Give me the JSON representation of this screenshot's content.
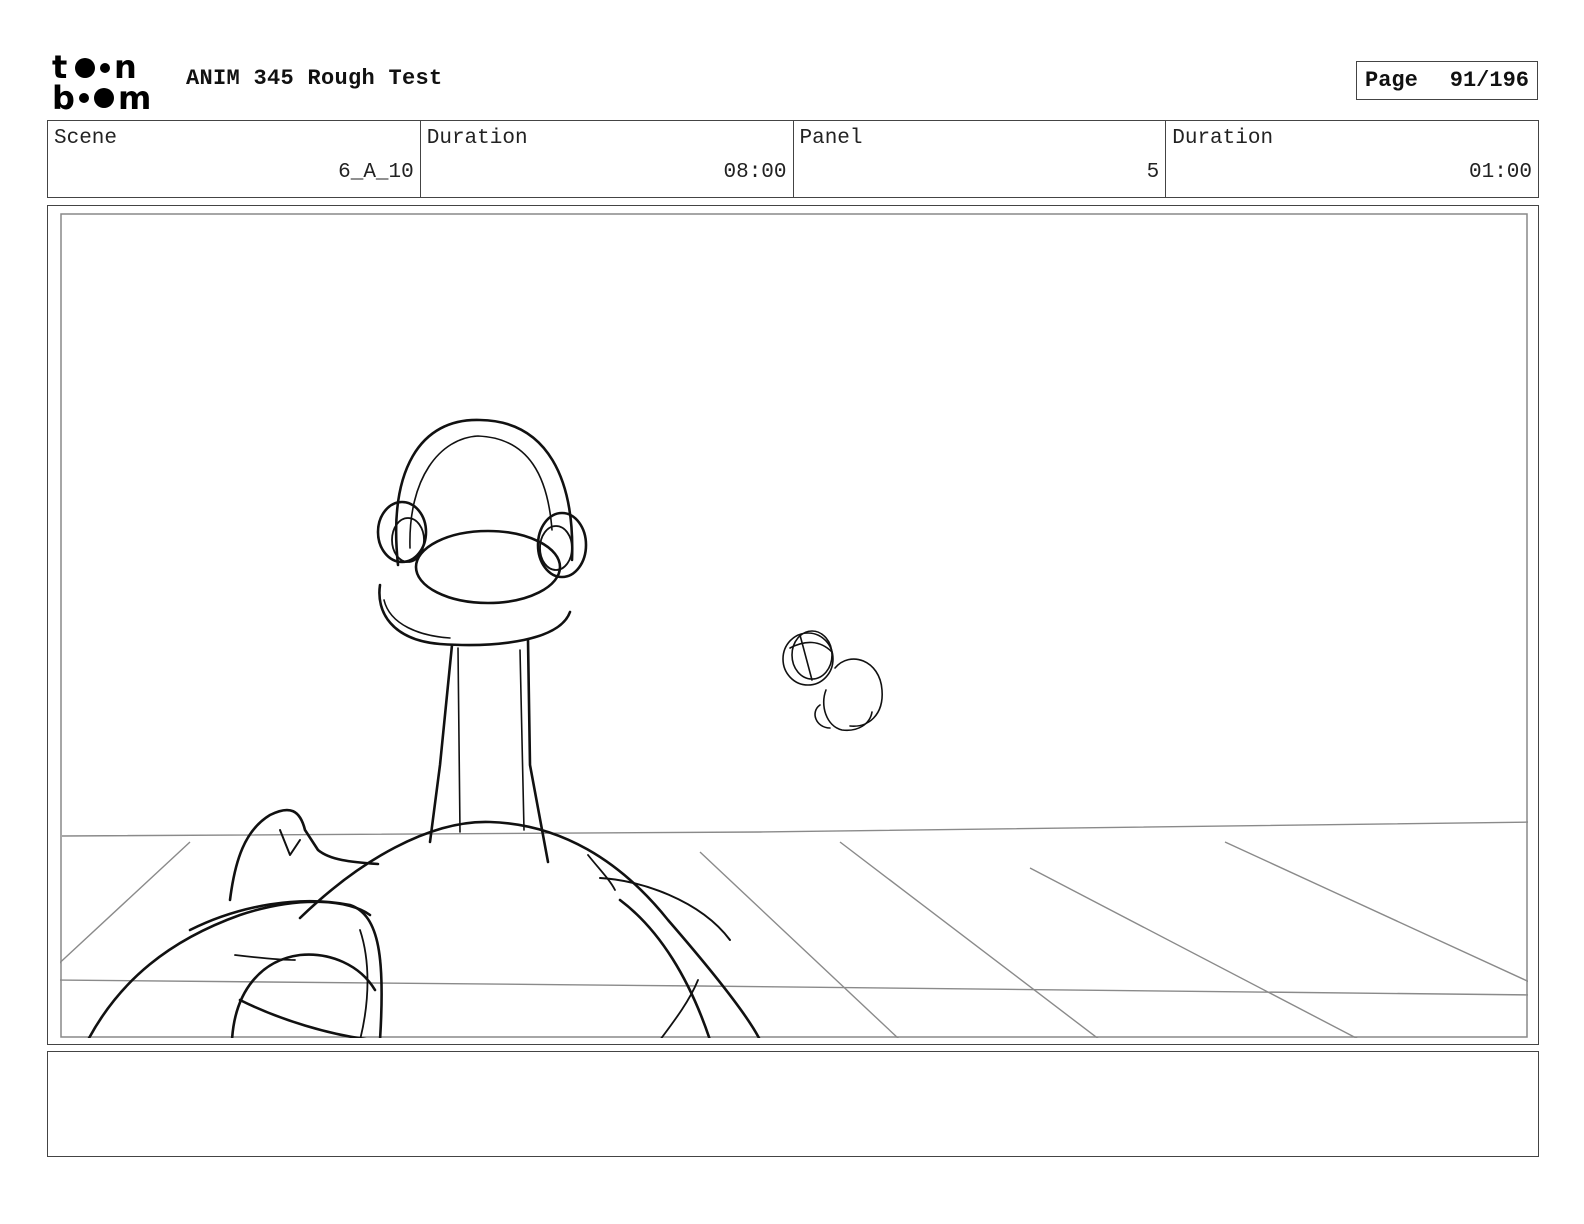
{
  "header": {
    "logo_text_top": "toon",
    "logo_text_bottom": "boom",
    "title": "ANIM 345 Rough Test",
    "page_label": "Page",
    "page_value": "91/196"
  },
  "info": {
    "scene_label": "Scene",
    "scene_value": "6_A_10",
    "duration_label": "Duration",
    "duration_value": "08:00",
    "panel_label": "Panel",
    "panel_value": "5",
    "panel_duration_label": "Duration",
    "panel_duration_value": "01:00"
  },
  "caption": {
    "text": ""
  }
}
